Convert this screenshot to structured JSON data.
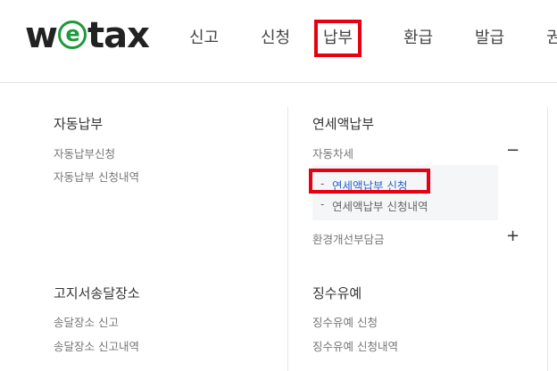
{
  "logo": {
    "pre": "w",
    "mid": "e",
    "post": "tax"
  },
  "nav": [
    "신고",
    "신청",
    "납부",
    "환급",
    "발급",
    "권"
  ],
  "left_column": {
    "sections": [
      {
        "title": "자동납부",
        "items": [
          "자동납부신청",
          "자동납부 신청내역"
        ]
      },
      {
        "title": "고지서송달장소",
        "items": [
          "송달장소 신고",
          "송달장소 신고내역"
        ]
      }
    ]
  },
  "right_column": {
    "section1_title": "연세액납부",
    "group1": {
      "label": "자동차세",
      "toggle": "−",
      "subitems": [
        "연세액납부 신청",
        "연세액납부 신청내역"
      ]
    },
    "group2": {
      "label": "환경개선부담금",
      "toggle": "+"
    },
    "section2_title": "징수유예",
    "section2_items": [
      "징수유예 신청",
      "징수유예 신청내역"
    ]
  },
  "colors": {
    "highlight": "#e60012",
    "logo_accent": "#1e9a3a",
    "active_link": "#2b66c8"
  }
}
